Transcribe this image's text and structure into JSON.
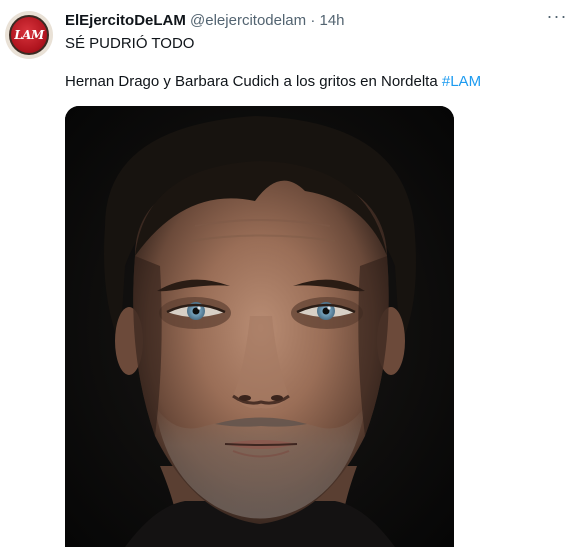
{
  "tweet": {
    "avatar_label": "LAM",
    "display_name": "ElEjercitoDeLAM",
    "handle": "@elejercitodelam",
    "separator": "·",
    "time": "14h",
    "more_label": "···",
    "text_line1": "SÉ PUDRIÓ TODO",
    "text_line2": "Hernan Drago y Barbara Cudich a los gritos en Nordelta",
    "hashtag": "#LAM",
    "media": {
      "type": "photo",
      "subject": "close-up portrait of a man with dark hair, light blue eyes and stubble on a black background"
    }
  },
  "colors": {
    "text": "#0f1419",
    "secondary": "#536471",
    "link": "#1d9bf0",
    "avatar_red": "#b0141e",
    "photo_background": "#0b0b0c"
  }
}
